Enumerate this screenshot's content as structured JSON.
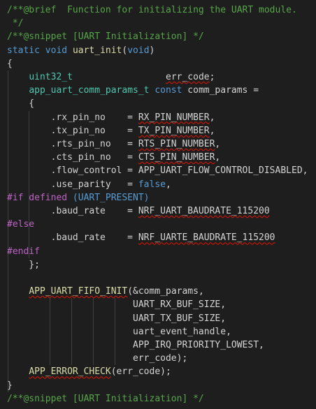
{
  "editor": {
    "language": "c",
    "colors": {
      "background": "#1e1e1e",
      "comment": "#57a64a",
      "keyword": "#569cd6",
      "type": "#4ec9b0",
      "function": "#dcdcaa",
      "macro": "#bd63c5",
      "text": "#d4d4d4",
      "error_squiggle": "#e51400"
    },
    "lines": [
      [
        {
          "t": "/**@brief  Function for initializing the UART module.",
          "c": "comment"
        }
      ],
      [
        {
          "t": " */",
          "c": "comment"
        }
      ],
      [
        {
          "t": "/**@snippet [UART Initialization] */",
          "c": "comment"
        }
      ],
      [
        {
          "t": "static",
          "c": "keyword"
        },
        {
          "t": " ",
          "c": "plain"
        },
        {
          "t": "void",
          "c": "keyword"
        },
        {
          "t": " ",
          "c": "plain"
        },
        {
          "t": "uart_init",
          "c": "func"
        },
        {
          "t": "(",
          "c": "plain"
        },
        {
          "t": "void",
          "c": "keyword"
        },
        {
          "t": ")",
          "c": "plain"
        }
      ],
      [
        {
          "t": "{",
          "c": "plain"
        }
      ],
      [
        {
          "t": "    ",
          "c": "plain"
        },
        {
          "t": "uint32_t",
          "c": "type"
        },
        {
          "t": "                 ",
          "c": "plain"
        },
        {
          "t": "err_code",
          "c": "plain",
          "sq": true
        },
        {
          "t": ";",
          "c": "plain"
        }
      ],
      [
        {
          "t": "    ",
          "c": "plain"
        },
        {
          "t": "app_uart_comm_params_t",
          "c": "type"
        },
        {
          "t": " ",
          "c": "plain"
        },
        {
          "t": "const",
          "c": "keyword"
        },
        {
          "t": " comm_params =",
          "c": "plain"
        }
      ],
      [
        {
          "t": "    {",
          "c": "plain"
        }
      ],
      [
        {
          "t": "        .rx_pin_no    = ",
          "c": "plain"
        },
        {
          "t": "RX_PIN_NUMBER",
          "c": "plain",
          "sq": true
        },
        {
          "t": ",",
          "c": "plain"
        }
      ],
      [
        {
          "t": "        .tx_pin_no    = ",
          "c": "plain"
        },
        {
          "t": "TX_PIN_NUMBER",
          "c": "plain",
          "sq": true
        },
        {
          "t": ",",
          "c": "plain"
        }
      ],
      [
        {
          "t": "        .rts_pin_no   = ",
          "c": "plain"
        },
        {
          "t": "RTS_PIN_NUMBER",
          "c": "plain",
          "sq": true
        },
        {
          "t": ",",
          "c": "plain"
        }
      ],
      [
        {
          "t": "        .cts_pin_no   = ",
          "c": "plain"
        },
        {
          "t": "CTS_PIN_NUMBER",
          "c": "plain",
          "sq": true
        },
        {
          "t": ",",
          "c": "plain"
        }
      ],
      [
        {
          "t": "        .flow_control = APP_UART_FLOW_CONTROL_DISABLED,",
          "c": "plain"
        }
      ],
      [
        {
          "t": "        .use_parity   = ",
          "c": "plain"
        },
        {
          "t": "false",
          "c": "keyword"
        },
        {
          "t": ",",
          "c": "plain"
        }
      ],
      [
        {
          "t": "#if defined",
          "c": "macro"
        },
        {
          "t": " (UART_PRESENT)",
          "c": "keyword"
        }
      ],
      [
        {
          "t": "        .baud_rate    = ",
          "c": "plain"
        },
        {
          "t": "NRF_UART_BAUDRATE_115200",
          "c": "plain",
          "sq": true
        }
      ],
      [
        {
          "t": "#else",
          "c": "macro"
        }
      ],
      [
        {
          "t": "        .baud_rate    = ",
          "c": "plain"
        },
        {
          "t": "NRF_UARTE_BAUDRATE_115200",
          "c": "plain",
          "sq": true
        }
      ],
      [
        {
          "t": "#endif",
          "c": "macro"
        }
      ],
      [
        {
          "t": "    };",
          "c": "plain"
        }
      ],
      [
        {
          "t": "",
          "c": "plain"
        }
      ],
      [
        {
          "t": "    ",
          "c": "plain"
        },
        {
          "t": "APP_UART_FIFO_INIT",
          "c": "func",
          "sq": true
        },
        {
          "t": "(&comm_params,",
          "c": "plain"
        }
      ],
      [
        {
          "t": "                       UART_RX_BUF_SIZE,",
          "c": "plain"
        }
      ],
      [
        {
          "t": "                       UART_TX_BUF_SIZE,",
          "c": "plain"
        }
      ],
      [
        {
          "t": "                       uart_event_handle,",
          "c": "plain"
        }
      ],
      [
        {
          "t": "                       APP_IRQ_PRIORITY_LOWEST,",
          "c": "plain"
        }
      ],
      [
        {
          "t": "                       err_code);",
          "c": "plain"
        }
      ],
      [
        {
          "t": "    ",
          "c": "plain"
        },
        {
          "t": "APP_ERROR_CHECK",
          "c": "func",
          "sq": true
        },
        {
          "t": "(err_code);",
          "c": "plain"
        }
      ],
      [
        {
          "t": "}",
          "c": "plain"
        }
      ],
      [
        {
          "t": "/**@snippet [UART Initialization] */",
          "c": "comment"
        }
      ]
    ]
  }
}
